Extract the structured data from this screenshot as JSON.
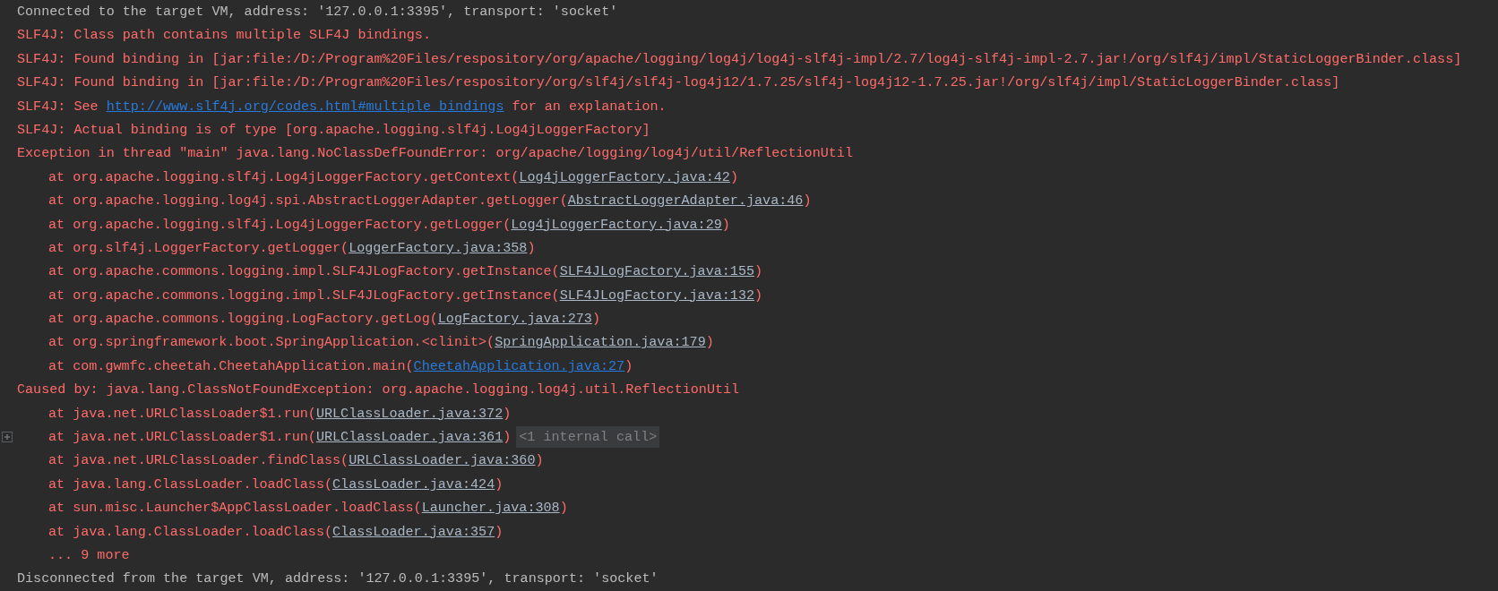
{
  "console": {
    "lines": [
      {
        "kind": "info",
        "expandable": false,
        "segments": [
          {
            "kind": "text",
            "text": "Connected to the target VM, address: '127.0.0.1:3395', transport: 'socket'"
          }
        ]
      },
      {
        "kind": "error",
        "expandable": false,
        "segments": [
          {
            "kind": "text",
            "text": "SLF4J: Class path contains multiple SLF4J bindings."
          }
        ]
      },
      {
        "kind": "error",
        "expandable": false,
        "segments": [
          {
            "kind": "text",
            "text": "SLF4J: Found binding in [jar:file:/D:/Program%20Files/respository/org/apache/logging/log4j/log4j-slf4j-impl/2.7/log4j-slf4j-impl-2.7.jar!/org/slf4j/impl/StaticLoggerBinder.class]"
          }
        ]
      },
      {
        "kind": "error",
        "expandable": false,
        "segments": [
          {
            "kind": "text",
            "text": "SLF4J: Found binding in [jar:file:/D:/Program%20Files/respository/org/slf4j/slf4j-log4j12/1.7.25/slf4j-log4j12-1.7.25.jar!/org/slf4j/impl/StaticLoggerBinder.class]"
          }
        ]
      },
      {
        "kind": "error",
        "expandable": false,
        "segments": [
          {
            "kind": "text",
            "text": "SLF4J: See "
          },
          {
            "kind": "url",
            "text": "http://www.slf4j.org/codes.html#multiple_bindings"
          },
          {
            "kind": "text",
            "text": " for an explanation."
          }
        ]
      },
      {
        "kind": "error",
        "expandable": false,
        "segments": [
          {
            "kind": "text",
            "text": "SLF4J: Actual binding is of type [org.apache.logging.slf4j.Log4jLoggerFactory]"
          }
        ]
      },
      {
        "kind": "error",
        "expandable": false,
        "segments": [
          {
            "kind": "text",
            "text": "Exception in thread \"main\" java.lang.NoClassDefFoundError: org/apache/logging/log4j/util/ReflectionUtil"
          }
        ]
      },
      {
        "kind": "frame",
        "expandable": false,
        "segments": [
          {
            "kind": "text",
            "text": "at org.apache.logging.slf4j.Log4jLoggerFactory.getContext("
          },
          {
            "kind": "source",
            "text": "Log4jLoggerFactory.java:42"
          },
          {
            "kind": "text",
            "text": ")"
          }
        ]
      },
      {
        "kind": "frame",
        "expandable": false,
        "segments": [
          {
            "kind": "text",
            "text": "at org.apache.logging.log4j.spi.AbstractLoggerAdapter.getLogger("
          },
          {
            "kind": "source",
            "text": "AbstractLoggerAdapter.java:46"
          },
          {
            "kind": "text",
            "text": ")"
          }
        ]
      },
      {
        "kind": "frame",
        "expandable": false,
        "segments": [
          {
            "kind": "text",
            "text": "at org.apache.logging.slf4j.Log4jLoggerFactory.getLogger("
          },
          {
            "kind": "source",
            "text": "Log4jLoggerFactory.java:29"
          },
          {
            "kind": "text",
            "text": ")"
          }
        ]
      },
      {
        "kind": "frame",
        "expandable": false,
        "segments": [
          {
            "kind": "text",
            "text": "at org.slf4j.LoggerFactory.getLogger("
          },
          {
            "kind": "source",
            "text": "LoggerFactory.java:358"
          },
          {
            "kind": "text",
            "text": ")"
          }
        ]
      },
      {
        "kind": "frame",
        "expandable": false,
        "segments": [
          {
            "kind": "text",
            "text": "at org.apache.commons.logging.impl.SLF4JLogFactory.getInstance("
          },
          {
            "kind": "source",
            "text": "SLF4JLogFactory.java:155"
          },
          {
            "kind": "text",
            "text": ")"
          }
        ]
      },
      {
        "kind": "frame",
        "expandable": false,
        "segments": [
          {
            "kind": "text",
            "text": "at org.apache.commons.logging.impl.SLF4JLogFactory.getInstance("
          },
          {
            "kind": "source",
            "text": "SLF4JLogFactory.java:132"
          },
          {
            "kind": "text",
            "text": ")"
          }
        ]
      },
      {
        "kind": "frame",
        "expandable": false,
        "segments": [
          {
            "kind": "text",
            "text": "at org.apache.commons.logging.LogFactory.getLog("
          },
          {
            "kind": "source",
            "text": "LogFactory.java:273"
          },
          {
            "kind": "text",
            "text": ")"
          }
        ]
      },
      {
        "kind": "frame",
        "expandable": false,
        "segments": [
          {
            "kind": "text",
            "text": "at org.springframework.boot.SpringApplication.<clinit>("
          },
          {
            "kind": "source",
            "text": "SpringApplication.java:179"
          },
          {
            "kind": "text",
            "text": ")"
          }
        ]
      },
      {
        "kind": "frame",
        "expandable": false,
        "segments": [
          {
            "kind": "text",
            "text": "at com.gwmfc.cheetah.CheetahApplication.main("
          },
          {
            "kind": "url",
            "text": "CheetahApplication.java:27"
          },
          {
            "kind": "text",
            "text": ")"
          }
        ]
      },
      {
        "kind": "error",
        "expandable": false,
        "segments": [
          {
            "kind": "text",
            "text": "Caused by: java.lang.ClassNotFoundException: org.apache.logging.log4j.util.ReflectionUtil"
          }
        ]
      },
      {
        "kind": "frame",
        "expandable": false,
        "segments": [
          {
            "kind": "text",
            "text": "at java.net.URLClassLoader$1.run("
          },
          {
            "kind": "source",
            "text": "URLClassLoader.java:372"
          },
          {
            "kind": "text",
            "text": ")"
          }
        ]
      },
      {
        "kind": "frame",
        "expandable": true,
        "segments": [
          {
            "kind": "text",
            "text": "at java.net.URLClassLoader$1.run("
          },
          {
            "kind": "source",
            "text": "URLClassLoader.java:361"
          },
          {
            "kind": "text",
            "text": ")"
          },
          {
            "kind": "collapsed",
            "text": "<1 internal call>"
          }
        ]
      },
      {
        "kind": "frame",
        "expandable": false,
        "segments": [
          {
            "kind": "text",
            "text": "at java.net.URLClassLoader.findClass("
          },
          {
            "kind": "source",
            "text": "URLClassLoader.java:360"
          },
          {
            "kind": "text",
            "text": ")"
          }
        ]
      },
      {
        "kind": "frame",
        "expandable": false,
        "segments": [
          {
            "kind": "text",
            "text": "at java.lang.ClassLoader.loadClass("
          },
          {
            "kind": "source",
            "text": "ClassLoader.java:424"
          },
          {
            "kind": "text",
            "text": ")"
          }
        ]
      },
      {
        "kind": "frame",
        "expandable": false,
        "segments": [
          {
            "kind": "text",
            "text": "at sun.misc.Launcher$AppClassLoader.loadClass("
          },
          {
            "kind": "source",
            "text": "Launcher.java:308"
          },
          {
            "kind": "text",
            "text": ")"
          }
        ]
      },
      {
        "kind": "frame",
        "expandable": false,
        "segments": [
          {
            "kind": "text",
            "text": "at java.lang.ClassLoader.loadClass("
          },
          {
            "kind": "source",
            "text": "ClassLoader.java:357"
          },
          {
            "kind": "text",
            "text": ")"
          }
        ]
      },
      {
        "kind": "frame",
        "expandable": false,
        "segments": [
          {
            "kind": "text",
            "text": "... 9 more"
          }
        ]
      },
      {
        "kind": "info",
        "expandable": false,
        "segments": [
          {
            "kind": "text",
            "text": "Disconnected from the target VM, address: '127.0.0.1:3395', transport: 'socket'"
          }
        ]
      }
    ]
  }
}
